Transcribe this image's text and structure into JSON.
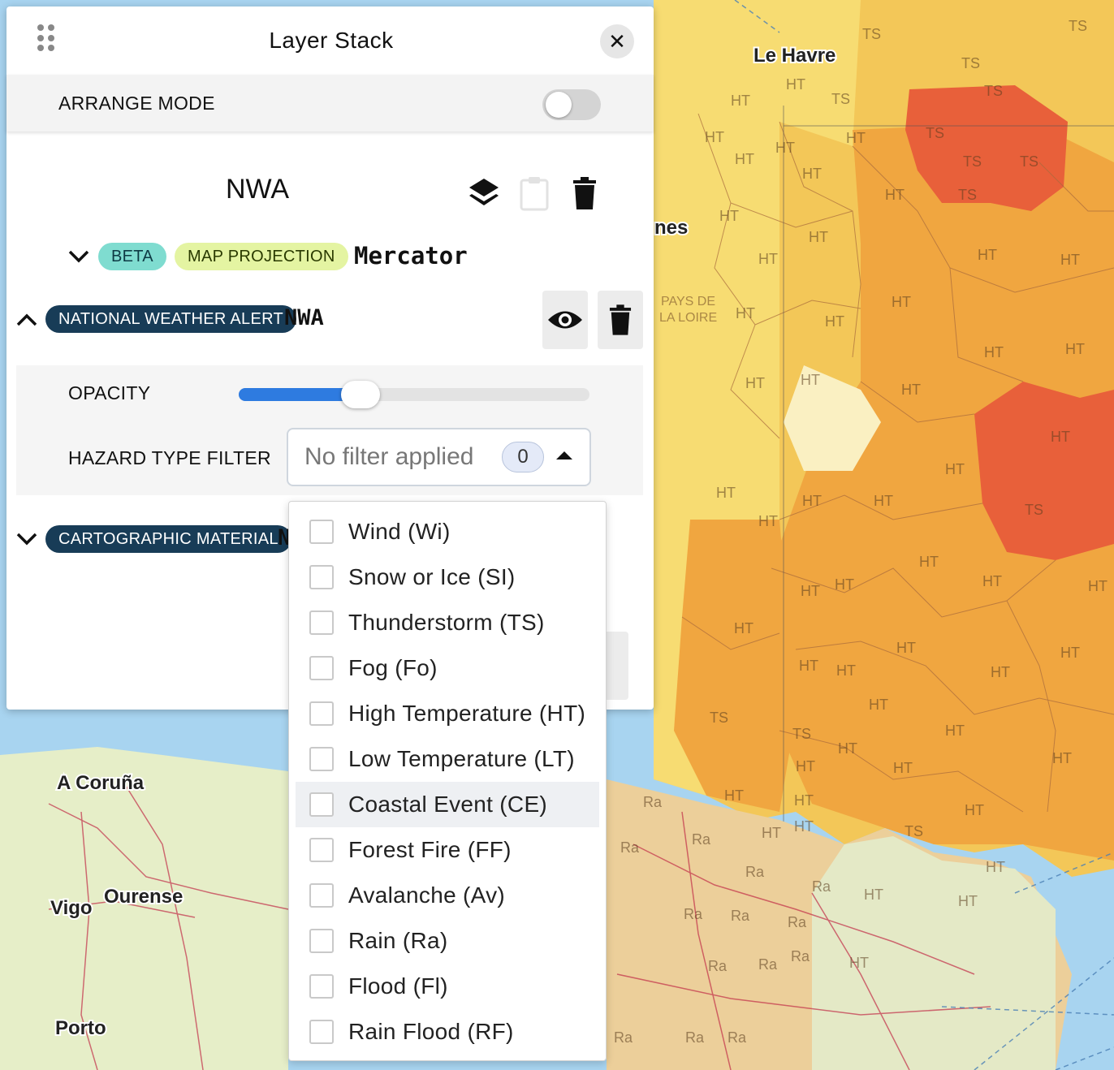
{
  "map": {
    "city_labels": [
      "Le Havre",
      "A Coruña",
      "Ourense",
      "Vigo",
      "Porto"
    ],
    "partial_labels": [
      "nes",
      "PAYS DE",
      "LA LOIRE"
    ],
    "hazard_codes": [
      "TS",
      "HT",
      "Ra"
    ],
    "colors": {
      "sea": "#a8d4f0",
      "alert_light": "#f5dc6e",
      "alert_medium": "#f0a640",
      "alert_strong": "#e8603a",
      "land_spain": "#e6eec8"
    }
  },
  "panel": {
    "title": "Layer Stack",
    "arrange_mode_label": "ARRANGE MODE",
    "arrange_mode_on": false,
    "group": {
      "title": "NWA",
      "beta_badge": "BETA",
      "projection_badge": "MAP PROJECTION",
      "projection_value": "Mercator"
    },
    "layer": {
      "type_badge": "NATIONAL WEATHER ALERT",
      "name": "NWA",
      "opacity_label": "OPACITY",
      "opacity_value": 0.32,
      "hazard_filter_label": "HAZARD TYPE FILTER",
      "hazard_filter_placeholder": "No filter applied",
      "hazard_filter_count": "0"
    },
    "second_layer": {
      "type_badge": "CARTOGRAPHIC MATERIAL",
      "name_partial": "N"
    }
  },
  "hazard_options": [
    "Wind (Wi)",
    "Snow or Ice (SI)",
    "Thunderstorm (TS)",
    "Fog (Fo)",
    "High Temperature (HT)",
    "Low Temperature (LT)",
    "Coastal Event (CE)",
    "Forest Fire (FF)",
    "Avalanche (Av)",
    "Rain (Ra)",
    "Flood (Fl)",
    "Rain Flood (RF)"
  ],
  "hovered_option": "Coastal Event (CE)"
}
